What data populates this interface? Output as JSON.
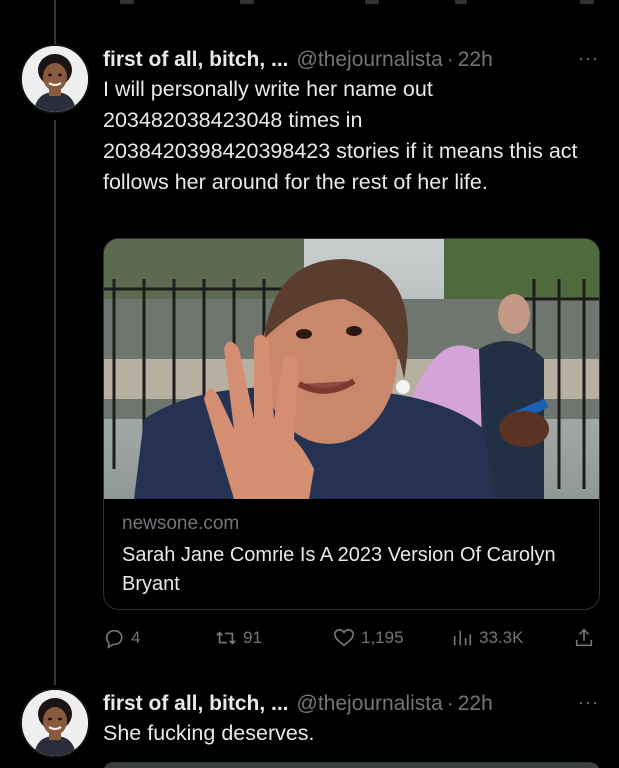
{
  "tweets": [
    {
      "name": "first of all, bitch, ...",
      "handle": "@thejournalista",
      "separator": "·",
      "time": "22h",
      "more": "···",
      "text": "I will personally write her name out 203482038423048 times in 2038420398420398423 stories if it means this act follows her around for the rest of her life.",
      "card": {
        "domain": "newsone.com",
        "title": "Sarah Jane Comrie Is A 2023 Version Of Carolyn Bryant"
      },
      "actions": {
        "replies": "4",
        "retweets": "91",
        "likes": "1,195",
        "views": "33.3K"
      }
    },
    {
      "name": "first of all, bitch, ...",
      "handle": "@thejournalista",
      "separator": "·",
      "time": "22h",
      "more": "···",
      "text": "She fucking deserves."
    }
  ],
  "colors": {
    "background": "#000000",
    "text_primary": "#e7e9ea",
    "text_secondary": "#71767b",
    "border": "#2f3336"
  },
  "icons": {
    "reply": "reply-icon",
    "retweet": "retweet-icon",
    "like": "heart-icon",
    "views": "views-chart-icon",
    "share": "share-icon"
  }
}
